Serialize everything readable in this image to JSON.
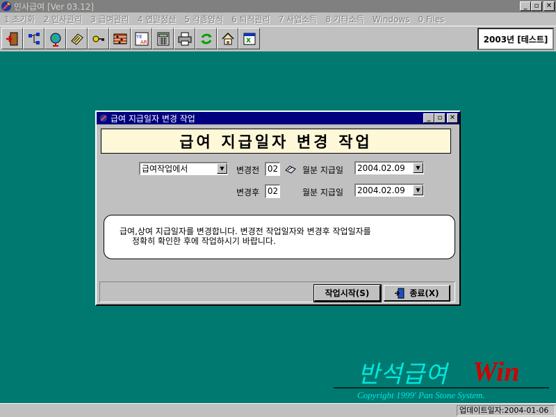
{
  "window": {
    "title": "인사급여 [Ver 03.12]",
    "buttons": {
      "minimize": "_",
      "restore": "▫",
      "close": "✕"
    }
  },
  "menu": [
    "1 초기화",
    "2 인사관리",
    "3 급여관리",
    "4 연말정산",
    "5 각종양식",
    "6 퇴직관리",
    "7 사업소득",
    "8  기타소득",
    "Windows",
    "0  Files"
  ],
  "toolbar": {
    "icons": [
      "exit-door-icon",
      "org-chart-icon",
      "globe-icon",
      "notebook-pencil-icon",
      "key-icon",
      "abacus-icon",
      "year-calendar-icon",
      "calculator-icon",
      "printer-icon",
      "refresh-icon",
      "home-icon",
      "excel-icon"
    ],
    "year_label": "2003년 [테스트]"
  },
  "dialog": {
    "title": "급여 지급일자 변경 작업",
    "banner": "급여 지급일자 변경 작업",
    "mode_select": "급여작업에서",
    "before_label": "변경전",
    "before_value": "02",
    "after_label": "변경후",
    "after_value": "02",
    "payday_label_1": "월분 지급일",
    "payday_value_1": "2004.02.09",
    "payday_label_2": "월분 지급일",
    "payday_value_2": "2004.02.09",
    "notice_line1": "급여,상여 지급일자를 변경합니다. 변경전 작업일자와 변경후 작업일자를",
    "notice_line2": "정확히 확인한 후에 작업하시기 바랍니다.",
    "start_button": "작업시작(S)",
    "close_button": "종료(X)"
  },
  "brand": {
    "name": "반석급여",
    "suffix": "Win",
    "copyright": "Copyright  1999'  Pan Stone System."
  },
  "status": {
    "update_date": "업데이트일자:2004-01-06"
  }
}
